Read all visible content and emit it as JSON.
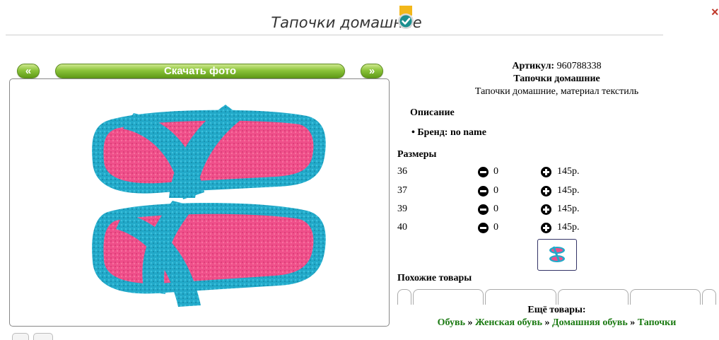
{
  "header": {
    "title": "Тапочки домашние",
    "close_glyph": "×"
  },
  "photo_nav": {
    "prev_label": "«",
    "next_label": "»",
    "download_label": "Скачать фото"
  },
  "product": {
    "article_label": "Артикул:",
    "article_value": "960788338",
    "name": "Тапочки домашние",
    "short_description": "Тапочки домашние, материал текстиль",
    "description_heading": "Описание",
    "brand": "Бренд: no name"
  },
  "sizes": {
    "heading": "Размеры",
    "rows": [
      {
        "size": "36",
        "qty": "0",
        "price": "145р."
      },
      {
        "size": "37",
        "qty": "0",
        "price": "145р."
      },
      {
        "size": "39",
        "qty": "0",
        "price": "145р."
      },
      {
        "size": "40",
        "qty": "0",
        "price": "145р."
      }
    ]
  },
  "similar": {
    "heading": "Похожие товары"
  },
  "more": {
    "heading": "Ещё товары:",
    "breadcrumb": [
      "Обувь",
      "Женская обувь",
      "Домашняя обувь",
      "Тапочки"
    ],
    "separator": "»"
  },
  "colors": {
    "accent_green": "#1b7a12",
    "button_green": "#7fb82e",
    "slipper_blue": "#1fa3c4",
    "slipper_pink": "#ee4d86"
  }
}
